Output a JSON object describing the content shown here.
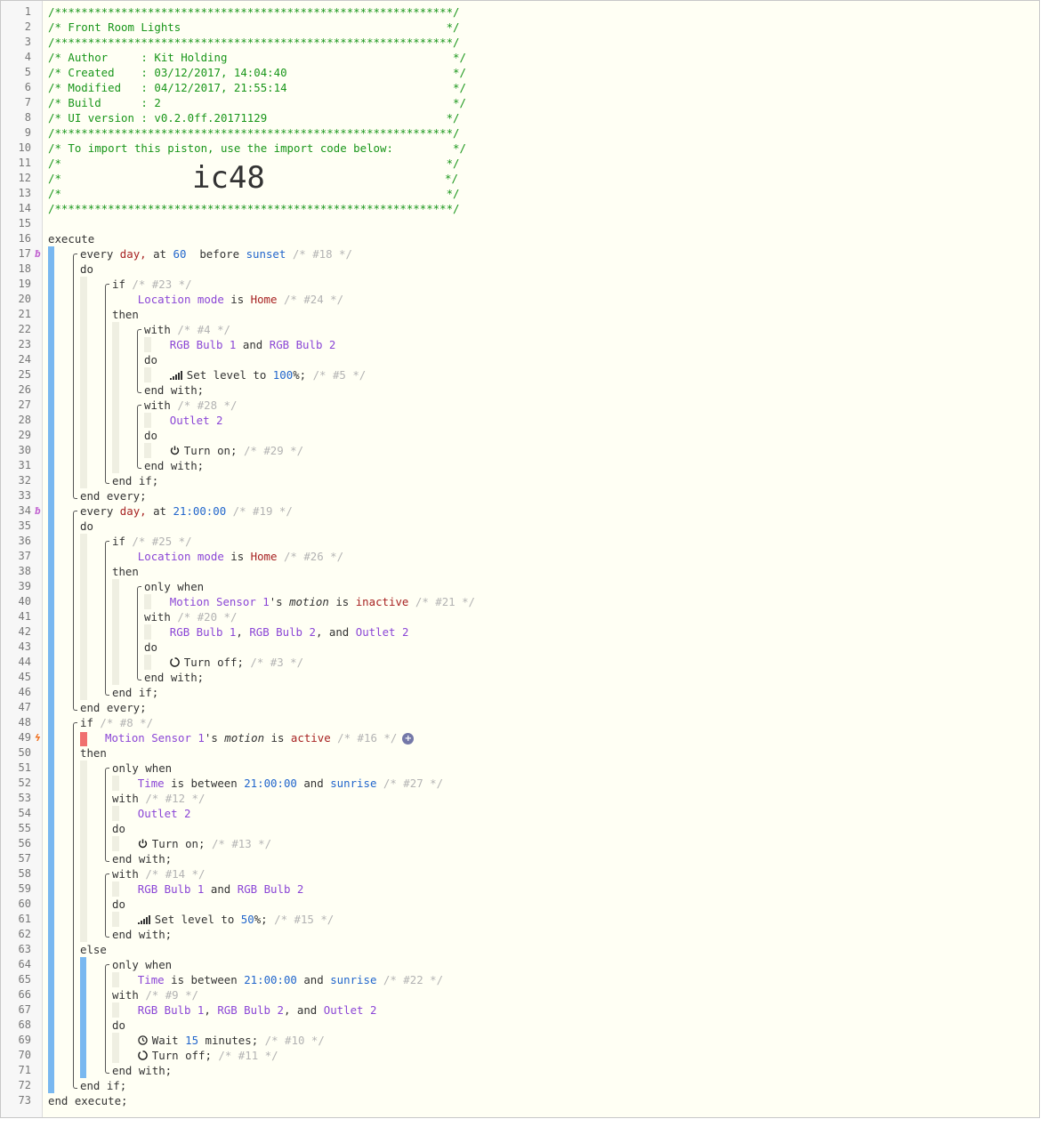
{
  "header": {
    "border_line": "/************************************************************/",
    "title": "/* Front Room Lights                                        */",
    "author": "/* Author     : Kit Holding                                  */",
    "created": "/* Created    : 03/12/2017, 14:04:40                         */",
    "modified": "/* Modified   : 04/12/2017, 21:55:14                         */",
    "build": "/* Build      : 2                                            */",
    "ui_version": "/* UI version : v0.2.0ff.20171129                           */",
    "import_note": "/* To import this piston, use the import code below:         */",
    "blank_comment": "/*                                                          */",
    "code_prefix": "/*",
    "code_suffix": "*/",
    "import_code": "ic48"
  },
  "kw": {
    "execute": "execute",
    "end_execute": "end execute;",
    "every": "every",
    "day": "day,",
    "at": "at",
    "before": "before",
    "do": "do",
    "if": "if",
    "then": "then",
    "else": "else",
    "with": "with",
    "end_with": "end with;",
    "end_if": "end if;",
    "end_every": "end every;",
    "only_when": "only when",
    "is": "is",
    "and": "and",
    "comma_and": ", and",
    "comma": ",",
    "is_between": "is between",
    "set_level_to": "Set level to",
    "pct": "%;",
    "turn_on": "Turn on;",
    "turn_off": "Turn off;",
    "wait": "Wait",
    "minutes_semi": "minutes;",
    "possessive": "'s",
    "minutes_word": "minutes"
  },
  "values": {
    "sixty": "60",
    "sunset": "sunset",
    "sunrise": "sunrise",
    "time_2100": "21:00:00",
    "hundred": "100",
    "fifty": "50",
    "fifteen": "15",
    "home": "Home",
    "inactive": "inactive",
    "active": "active",
    "motion": "motion"
  },
  "devices": {
    "location_mode": "Location mode",
    "rgb1": "RGB Bulb 1",
    "rgb2": "RGB Bulb 2",
    "outlet2": "Outlet 2",
    "motion1": "Motion Sensor 1",
    "time": "Time"
  },
  "ids": {
    "c18": "/* #18 */",
    "c23": "/* #23 */",
    "c24": "/* #24 */",
    "c4": "/* #4 */",
    "c5": "/* #5 */",
    "c28": "/* #28 */",
    "c29": "/* #29 */",
    "c19": "/* #19 */",
    "c25": "/* #25 */",
    "c26": "/* #26 */",
    "c21": "/* #21 */",
    "c20": "/* #20 */",
    "c3": "/* #3 */",
    "c8": "/* #8 */",
    "c16": "/* #16 */",
    "c27": "/* #27 */",
    "c12": "/* #12 */",
    "c13": "/* #13 */",
    "c14": "/* #14 */",
    "c15": "/* #15 */",
    "c22": "/* #22 */",
    "c9": "/* #9 */",
    "c10": "/* #10 */",
    "c11": "/* #11 */"
  },
  "gutter_marks": {
    "trigger": "ƀ",
    "event": "ϟ"
  },
  "add_button": "+",
  "colors": {
    "comment": "#19961a",
    "device": "#8b46d6",
    "number": "#2266cc",
    "string": "#a72222",
    "bar_blue": "#79b8f0",
    "bar_beige": "#efefe2",
    "error": "#f07070"
  }
}
